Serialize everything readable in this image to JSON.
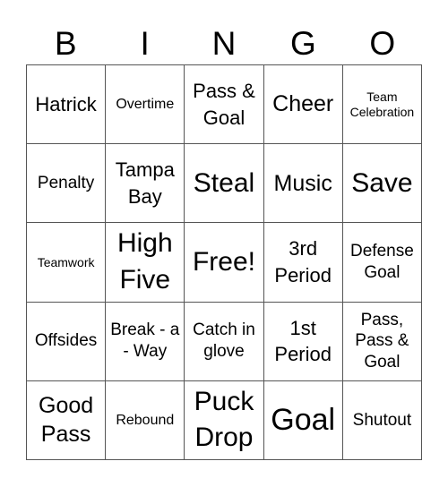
{
  "header": [
    "B",
    "I",
    "N",
    "G",
    "O"
  ],
  "cells": [
    {
      "text": "Hatrick",
      "size": "s4"
    },
    {
      "text": "Overtime",
      "size": "s2"
    },
    {
      "text": "Pass & Goal",
      "size": "s4"
    },
    {
      "text": "Cheer",
      "size": "s5"
    },
    {
      "text": "Team Celebration",
      "size": "s1"
    },
    {
      "text": "Penalty",
      "size": "s3"
    },
    {
      "text": "Tampa Bay",
      "size": "s4"
    },
    {
      "text": "Steal",
      "size": "s6"
    },
    {
      "text": "Music",
      "size": "s5"
    },
    {
      "text": "Save",
      "size": "s6"
    },
    {
      "text": "Teamwork",
      "size": "s1"
    },
    {
      "text": "High Five",
      "size": "s6"
    },
    {
      "text": "Free!",
      "size": "s6"
    },
    {
      "text": "3rd Period",
      "size": "s4"
    },
    {
      "text": "Defense Goal",
      "size": "s3"
    },
    {
      "text": "Offsides",
      "size": "s3"
    },
    {
      "text": "Break - a - Way",
      "size": "s3"
    },
    {
      "text": "Catch in glove",
      "size": "s3"
    },
    {
      "text": "1st Period",
      "size": "s4"
    },
    {
      "text": "Pass, Pass & Goal",
      "size": "s3"
    },
    {
      "text": "Good Pass",
      "size": "s5"
    },
    {
      "text": "Rebound",
      "size": "s2"
    },
    {
      "text": "Puck Drop",
      "size": "s6"
    },
    {
      "text": "Goal",
      "size": "s7"
    },
    {
      "text": "Shutout",
      "size": "s3"
    }
  ]
}
